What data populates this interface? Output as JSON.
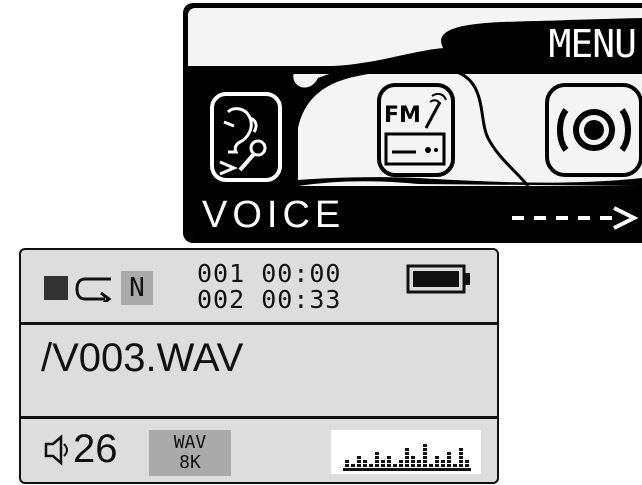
{
  "menu": {
    "title": "MENU",
    "selected_label": "VOICE",
    "icons": [
      {
        "name": "voice-recorder-icon",
        "text": ""
      },
      {
        "name": "fm-radio-icon",
        "text": "FM"
      },
      {
        "name": "speaker-icon",
        "text": ""
      }
    ],
    "next_arrow": "---->"
  },
  "player": {
    "stop_icon": "stop-icon",
    "repeat_icon": "repeat-icon",
    "mode": "N",
    "track_current": "001",
    "time_current": "00:00",
    "track_total": "002",
    "time_total": "00:33",
    "battery_icon": "battery-full-icon",
    "file_path": "/V003.WAV",
    "volume_icon": "speaker-volume-icon",
    "volume": "26",
    "format": "WAV",
    "bitrate": "8K",
    "equalizer_levels": [
      2,
      1,
      3,
      2,
      1,
      4,
      2,
      3,
      1,
      2,
      5,
      3,
      2,
      6,
      1,
      3,
      2,
      4,
      1,
      5,
      2
    ]
  }
}
